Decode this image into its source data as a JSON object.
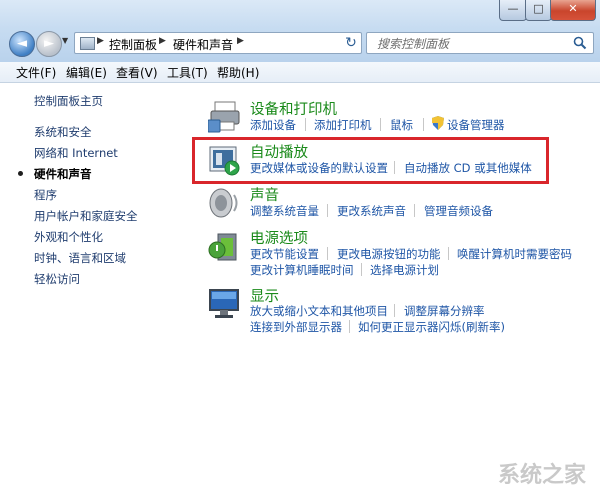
{
  "window": {
    "controls": {
      "minimize": "—",
      "maximize": "□",
      "close": "✕"
    }
  },
  "nav": {
    "back_glyph": "◄",
    "forward_glyph": "►",
    "history_glyph": "▼",
    "breadcrumb": [
      "控制面板",
      "硬件和声音"
    ],
    "refresh_glyph": "↻"
  },
  "search": {
    "placeholder": "搜索控制面板"
  },
  "menu": [
    "文件(F)",
    "编辑(E)",
    "查看(V)",
    "工具(T)",
    "帮助(H)"
  ],
  "sidebar": {
    "home": "控制面板主页",
    "items": [
      "系统和安全",
      "网络和 Internet",
      "硬件和声音",
      "程序",
      "用户帐户和家庭安全",
      "外观和个性化",
      "时钟、语言和区域",
      "轻松访问"
    ],
    "current_index": 2
  },
  "categories": {
    "devices": {
      "title": "设备和打印机",
      "links": [
        "添加设备",
        "添加打印机",
        "鼠标",
        "设备管理器"
      ]
    },
    "autoplay": {
      "title": "自动播放",
      "links": [
        "更改媒体或设备的默认设置",
        "自动播放 CD 或其他媒体"
      ]
    },
    "sound": {
      "title": "声音",
      "links": [
        "调整系统音量",
        "更改系统声音",
        "管理音频设备"
      ]
    },
    "power": {
      "title": "电源选项",
      "links": [
        "更改节能设置",
        "更改电源按钮的功能",
        "唤醒计算机时需要密码",
        "更改计算机睡眠时间",
        "选择电源计划"
      ]
    },
    "display": {
      "title": "显示",
      "links": [
        "放大或缩小文本和其他项目",
        "调整屏幕分辨率",
        "连接到外部显示器",
        "如何更正显示器闪烁(刷新率)"
      ]
    }
  },
  "watermark": "系统之家",
  "colors": {
    "highlight_border": "#d9262b",
    "category_title": "#1a8a1a",
    "link": "#1f56a6"
  }
}
